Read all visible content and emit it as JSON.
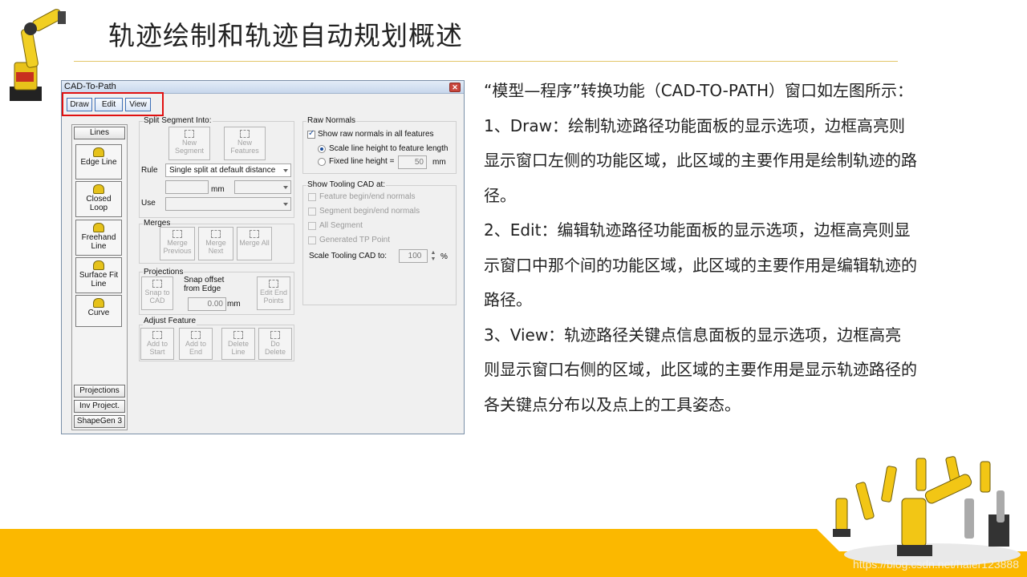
{
  "slide": {
    "title": "轨迹绘制和轨迹自动规划概述",
    "watermark": "https://blog.csdn.net/haier123888",
    "colors": {
      "accent_band": "#fbb800",
      "title_rule": "#e2c66a",
      "highlight": "#e01010"
    }
  },
  "description": [
    "“模型—程序”转换功能（CAD-TO-PATH）窗口如左图所示：",
    "1、Draw：绘制轨迹路径功能面板的显示选项，边框高亮则显示窗口左侧的功能区域，此区域的主要作用是绘制轨迹的路径。",
    "2、Edit：编辑轨迹路径功能面板的显示选项，边框高亮则显示窗口中那个间的功能区域，此区域的主要作用是编辑轨迹的路径。",
    "3、View：轨迹路径关键点信息面板的显示选项，边框高亮则显示窗口右侧的区域，此区域的主要作用是显示轨迹路径的各关键点分布以及点上的工具姿态。"
  ],
  "window": {
    "title": "CAD-To-Path",
    "mode_buttons": [
      "Draw",
      "Edit",
      "View"
    ],
    "left_tabs": {
      "lines": "Lines",
      "projections": "Projections",
      "inv_project": "Inv Project.",
      "shapegen": "ShapeGen 3"
    },
    "tools": [
      "Edge Line",
      "Closed Loop",
      "Freehand Line",
      "Surface Fit Line",
      "Curve"
    ],
    "split": {
      "label": "Split Segment Into:",
      "new_segment": "New Segment",
      "new_features": "New Features",
      "rule_label": "Rule",
      "rule_value": "Single split at default distance",
      "mm": "mm",
      "use_label": "Use"
    },
    "merges": {
      "label": "Merges",
      "previous": "Merge Previous",
      "next": "Merge Next",
      "all": "Merge All"
    },
    "projections": {
      "label": "Projections",
      "snap_cad": "Snap to CAD",
      "snap_offset": "Snap offset from Edge",
      "offset_value": "0.00",
      "mm": "mm",
      "edit_end": "Edit End Points"
    },
    "adjust": {
      "label": "Adjust Feature",
      "add_start": "Add to Start",
      "add_end": "Add to End",
      "delete_line": "Delete Line",
      "do_delete": "Do Delete"
    },
    "raw_normals": {
      "label": "Raw Normals",
      "show_all": "Show raw normals in all features",
      "scale_line": "Scale line height to feature length",
      "fixed_line": "Fixed line height =",
      "fixed_value": "50",
      "mm": "mm"
    },
    "tooling": {
      "label": "Show Tooling CAD at:",
      "items": [
        "Feature begin/end normals",
        "Segment begin/end normals",
        "All Segment",
        "Generated TP Point"
      ],
      "scale_label": "Scale Tooling CAD to:",
      "scale_value": "100",
      "pct": "%"
    }
  }
}
